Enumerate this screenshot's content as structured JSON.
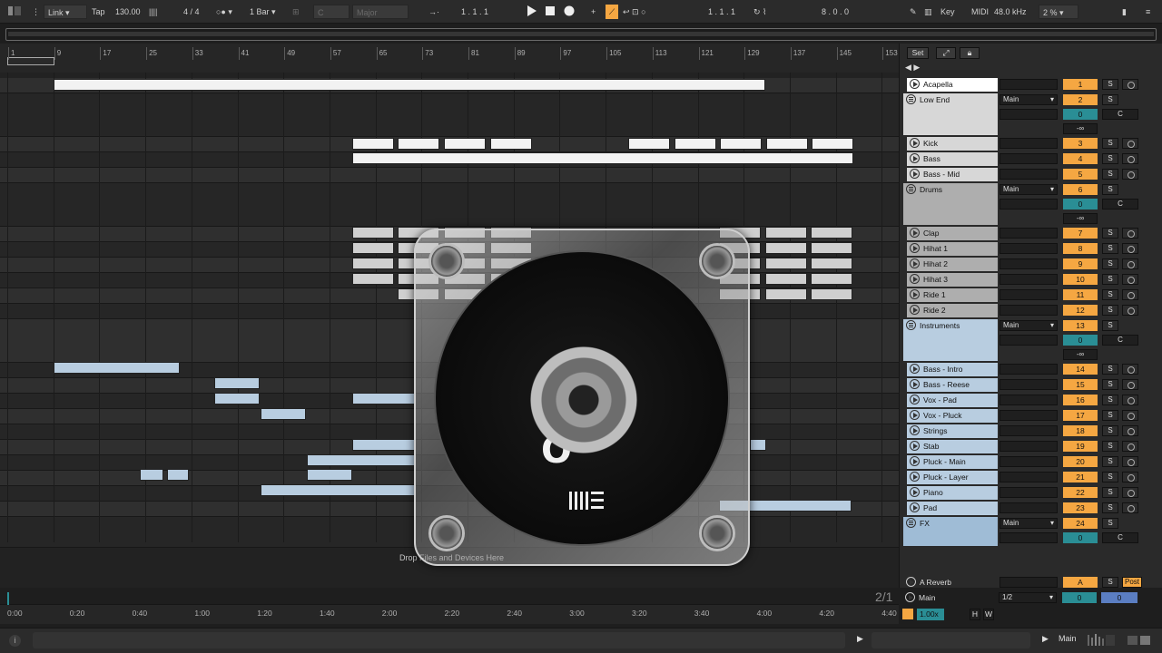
{
  "transport": {
    "link": "Link",
    "tap": "Tap",
    "tempo": "130.00",
    "signature": "4 / 4",
    "quantize": "1 Bar",
    "key": "C",
    "scale": "Major",
    "position": "1 .  1 .  1",
    "loop_start": "1 .  1 .  1",
    "loop_length": "8 .  0 .  0",
    "key_label": "Key",
    "midi_label": "MIDI",
    "sample_rate": "48.0 kHz",
    "cpu": "2 %"
  },
  "ruler": {
    "bars": [
      "1",
      "9",
      "17",
      "25",
      "33",
      "41",
      "49",
      "57",
      "65",
      "73",
      "81",
      "89",
      "97",
      "105",
      "113",
      "121",
      "129",
      "137",
      "145",
      "153"
    ]
  },
  "panel": {
    "set_label": "Set"
  },
  "tracks": [
    {
      "name": "Acapella",
      "type": "audio",
      "color": "#ffffff",
      "number": "1"
    },
    {
      "name": "Low End",
      "type": "group",
      "color": "#d7d7d7",
      "number": "2",
      "output": "Main",
      "volume": "0",
      "pan": "C",
      "send": "-∞"
    },
    {
      "name": "Kick",
      "type": "audio",
      "color": "#d7d7d7",
      "number": "3"
    },
    {
      "name": "Bass",
      "type": "audio",
      "color": "#d7d7d7",
      "number": "4"
    },
    {
      "name": "Bass - Mid",
      "type": "audio",
      "color": "#d7d7d7",
      "number": "5"
    },
    {
      "name": "Drums",
      "type": "group",
      "color": "#aeaeae",
      "number": "6",
      "output": "Main",
      "volume": "0",
      "pan": "C",
      "send": "-∞"
    },
    {
      "name": "Clap",
      "type": "audio",
      "color": "#aeaeae",
      "number": "7"
    },
    {
      "name": "Hihat 1",
      "type": "audio",
      "color": "#aeaeae",
      "number": "8"
    },
    {
      "name": "Hihat 2",
      "type": "audio",
      "color": "#aeaeae",
      "number": "9"
    },
    {
      "name": "Hihat 3",
      "type": "audio",
      "color": "#aeaeae",
      "number": "10"
    },
    {
      "name": "Ride 1",
      "type": "audio",
      "color": "#aeaeae",
      "number": "11"
    },
    {
      "name": "Ride 2",
      "type": "audio",
      "color": "#aeaeae",
      "number": "12"
    },
    {
      "name": "Instruments",
      "type": "group",
      "color": "#b8cde0",
      "number": "13",
      "output": "Main",
      "volume": "0",
      "pan": "C",
      "send": "-∞"
    },
    {
      "name": "Bass - Intro",
      "type": "audio",
      "color": "#b8cde0",
      "number": "14"
    },
    {
      "name": "Bass - Reese",
      "type": "audio",
      "color": "#b8cde0",
      "number": "15"
    },
    {
      "name": "Vox - Pad",
      "type": "audio",
      "color": "#b8cde0",
      "number": "16"
    },
    {
      "name": "Vox - Pluck",
      "type": "audio",
      "color": "#b8cde0",
      "number": "17"
    },
    {
      "name": "Strings",
      "type": "audio",
      "color": "#b8cde0",
      "number": "18"
    },
    {
      "name": "Stab",
      "type": "audio",
      "color": "#b8cde0",
      "number": "19"
    },
    {
      "name": "Pluck - Main",
      "type": "audio",
      "color": "#b8cde0",
      "number": "20"
    },
    {
      "name": "Pluck - Layer",
      "type": "audio",
      "color": "#b8cde0",
      "number": "21"
    },
    {
      "name": "Piano",
      "type": "audio",
      "color": "#b8cde0",
      "number": "22"
    },
    {
      "name": "Pad",
      "type": "audio",
      "color": "#b8cde0",
      "number": "23"
    },
    {
      "name": "FX",
      "type": "group",
      "color": "#9fbcd6",
      "number": "24",
      "output": "Main",
      "volume": "0",
      "pan": "C"
    }
  ],
  "returns": [
    {
      "name": "A Reverb",
      "letter": "A",
      "solo": "S",
      "post": "Post"
    },
    {
      "name": "Main",
      "output": "1/2",
      "volume": "0",
      "pan": "0"
    }
  ],
  "drop_hint": "Drop Files and Devices Here",
  "disc_title": "T  O",
  "page_indicator": "2/1",
  "time_ruler": [
    "0:00",
    "0:20",
    "0:40",
    "1:00",
    "1:20",
    "1:40",
    "2:00",
    "2:20",
    "2:40",
    "3:00",
    "3:20",
    "3:40",
    "4:00",
    "4:20",
    "4:40"
  ],
  "zoom": "1.00x",
  "hw_buttons": [
    "H",
    "W"
  ],
  "status": {
    "output": "Main"
  },
  "solo_label": "S"
}
